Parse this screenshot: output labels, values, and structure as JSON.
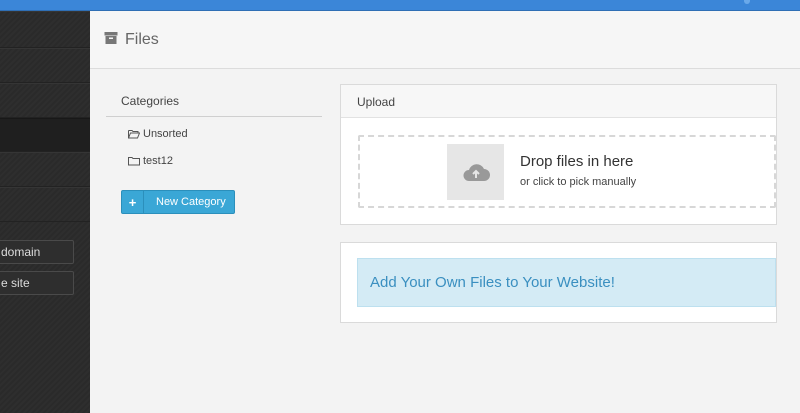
{
  "sidebar": {
    "buttons": [
      "domain",
      "e site"
    ]
  },
  "header": {
    "title": "Files",
    "icon": "archive-icon"
  },
  "categories": {
    "title": "Categories",
    "items": [
      {
        "label": "Unsorted",
        "icon": "folder-open-icon"
      },
      {
        "label": "test12",
        "icon": "folder-icon"
      }
    ],
    "new_button_label": "New Category"
  },
  "upload": {
    "title": "Upload",
    "drop_main": "Drop files in here",
    "drop_sub": "or click to pick manually",
    "icon": "cloud-upload-icon"
  },
  "promo": {
    "text": "Add Your Own Files to Your Website!"
  },
  "colors": {
    "topbar": "#3b86d8",
    "sidebar": "#2b2b2b",
    "accent_button": "#3aa7d6",
    "promo_bg": "#d4ebf5",
    "promo_text": "#3a8fc0"
  }
}
